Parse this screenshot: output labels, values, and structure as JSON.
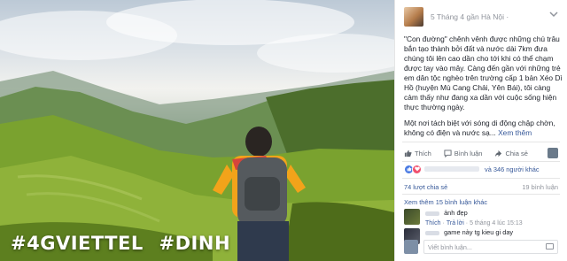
{
  "photo": {
    "hashtags": [
      "#4GVIETTEL",
      "#DINH"
    ]
  },
  "post": {
    "meta": "5 Tháng 4 gần Hà Nội ·",
    "paragraph1": "\"Con đường\" chênh vênh được những chú trâu bắn tạo thành bởi đất và nước dài 7km đưa chúng tôi lên cao dần cho tới khi có thể chạm được tay vào mây. Càng đến gần với những trẻ em dân tộc nghèo trên trường cấp 1 bản Xéo Dì Hồ (huyện Mù Cang Chải, Yên Bái), tôi càng cảm thấy như đang xa dần với cuộc sống hiện thực thường ngày.",
    "paragraph2": "Một nơi tách biệt với sóng di động chập chờn, không có điện và nước sạ...",
    "see_more": "Xem thêm"
  },
  "actions": {
    "like": "Thích",
    "comment": "Bình luận",
    "share": "Chia sẻ"
  },
  "reactions": {
    "others": "và 346 người khác"
  },
  "counts": {
    "shares": "74 lượt chia sẻ",
    "comments": "19 bình luận"
  },
  "comments": {
    "see_more": "Xem thêm 15 bình luận khác",
    "items": [
      {
        "text": "ảnh đẹp",
        "like": "Thích",
        "reply": "Trả lời",
        "timestamp": "5 tháng 4 lúc 15:13"
      },
      {
        "text": "game này tg kieu gi day"
      }
    ],
    "reply_placeholder": "Viết bình luận..."
  },
  "icons": [
    "more-menu-icon",
    "like-icon",
    "comment-icon",
    "share-icon",
    "like-reaction-icon",
    "love-reaction-icon",
    "camera-icon"
  ],
  "colors": {
    "link": "#365899",
    "text": "#1d2129",
    "muted": "#90949c",
    "like_blue": "#4a7ae3",
    "love_red": "#f0506e"
  }
}
